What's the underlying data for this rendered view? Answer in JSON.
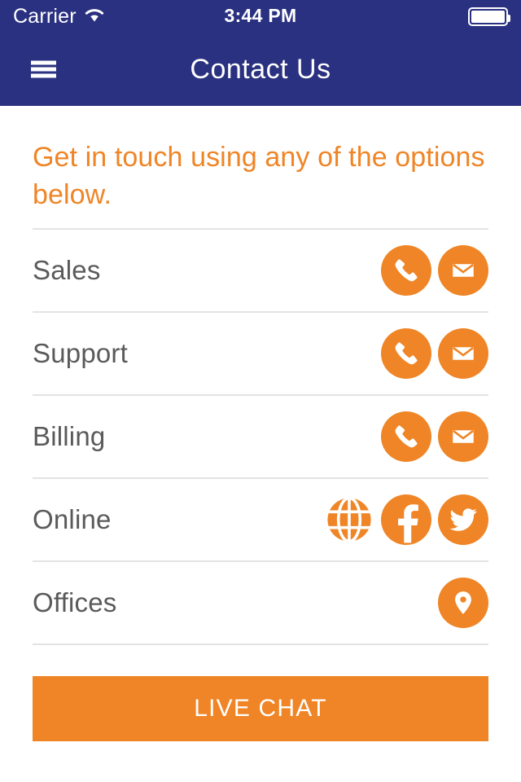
{
  "status_bar": {
    "carrier": "Carrier",
    "wifi_icon": "wifi-icon",
    "time": "3:44 PM",
    "battery_icon": "battery-full-icon"
  },
  "nav": {
    "menu_icon": "hamburger-menu-icon",
    "title": "Contact Us"
  },
  "main": {
    "intro": "Get in touch using any of the options below.",
    "rows": [
      {
        "label": "Sales",
        "icons": [
          {
            "name": "phone-icon",
            "style": "circle"
          },
          {
            "name": "email-icon",
            "style": "circle"
          }
        ]
      },
      {
        "label": "Support",
        "icons": [
          {
            "name": "phone-icon",
            "style": "circle"
          },
          {
            "name": "email-icon",
            "style": "circle"
          }
        ]
      },
      {
        "label": "Billing",
        "icons": [
          {
            "name": "phone-icon",
            "style": "circle"
          },
          {
            "name": "email-icon",
            "style": "circle"
          }
        ]
      },
      {
        "label": "Online",
        "icons": [
          {
            "name": "globe-icon",
            "style": "plain"
          },
          {
            "name": "facebook-icon",
            "style": "circle"
          },
          {
            "name": "twitter-icon",
            "style": "circle"
          }
        ]
      },
      {
        "label": "Offices",
        "icons": [
          {
            "name": "map-pin-icon",
            "style": "circle"
          }
        ]
      }
    ],
    "live_chat_label": "LIVE CHAT"
  },
  "colors": {
    "navy": "#2A3180",
    "orange": "#EF8526",
    "label_gray": "#5A5A5A",
    "divider": "#E3E3E3",
    "white": "#FFFFFF"
  }
}
